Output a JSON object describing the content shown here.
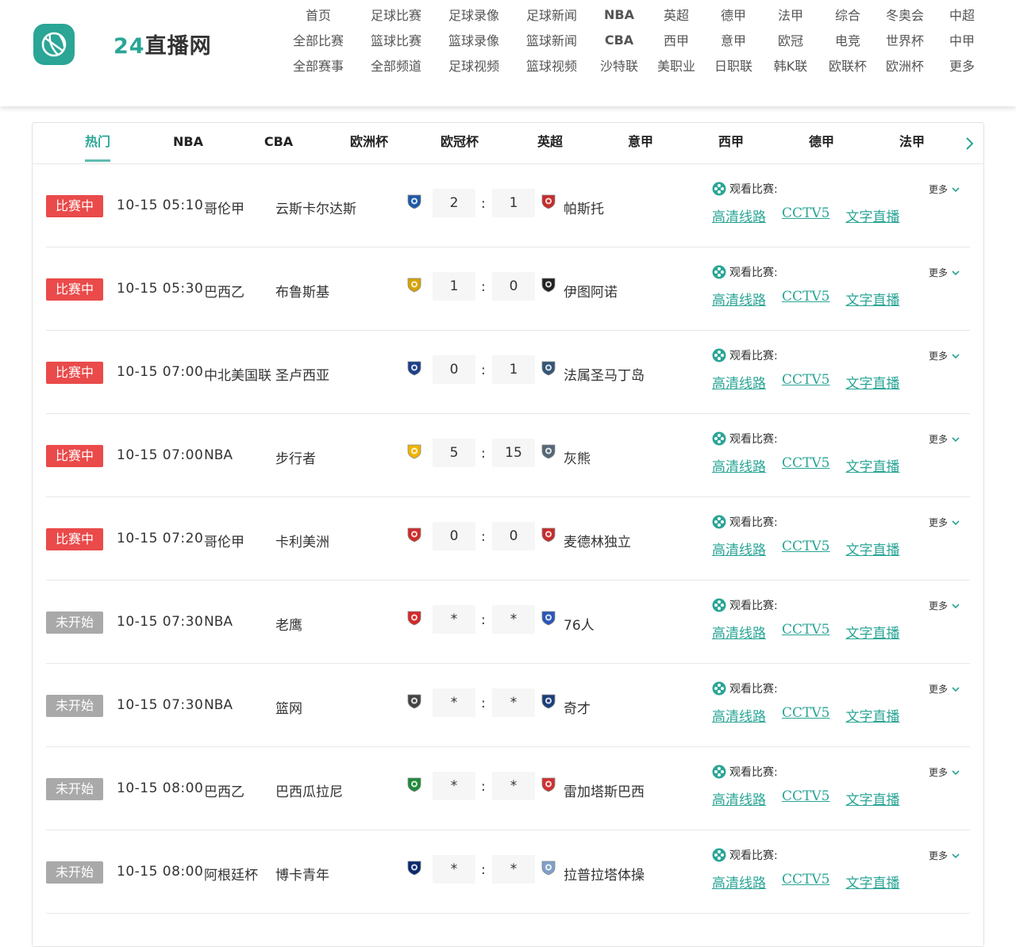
{
  "site": {
    "logo_prefix": "24",
    "logo_suffix": "直播网",
    "accent": "#2aa596"
  },
  "nav": [
    [
      "首页",
      "足球比赛",
      "足球录像",
      "足球新闻",
      "NBA",
      "英超",
      "德甲",
      "法甲",
      "综合",
      "冬奥会",
      "中超"
    ],
    [
      "全部比赛",
      "篮球比赛",
      "篮球录像",
      "篮球新闻",
      "CBA",
      "西甲",
      "意甲",
      "欧冠",
      "电竞",
      "世界杯",
      "中甲"
    ],
    [
      "全部赛事",
      "全部频道",
      "足球视频",
      "篮球视频",
      "沙特联",
      "美职业",
      "日职联",
      "韩K联",
      "欧联杯",
      "欧洲杯",
      "更多"
    ]
  ],
  "tabs": [
    "热门",
    "NBA",
    "CBA",
    "欧洲杯",
    "欧冠杯",
    "英超",
    "意甲",
    "西甲",
    "德甲",
    "法甲"
  ],
  "labels": {
    "watch": "观看比赛:",
    "more": "更多"
  },
  "matches": [
    {
      "status": "比赛中",
      "state": "live",
      "time": "10-15 05:10",
      "league": "哥伦甲",
      "home": "云斯卡尔达斯",
      "home_score": "2",
      "away_score": "1",
      "away": "帕斯托",
      "links": [
        "高清线路",
        "CCTV5",
        "文字直播"
      ]
    },
    {
      "status": "比赛中",
      "state": "live",
      "time": "10-15 05:30",
      "league": "巴西乙",
      "home": "布鲁斯基",
      "home_score": "1",
      "away_score": "0",
      "away": "伊图阿诺",
      "links": [
        "高清线路",
        "CCTV5",
        "文字直播"
      ]
    },
    {
      "status": "比赛中",
      "state": "live",
      "time": "10-15 07:00",
      "league": "中北美国联",
      "home": "圣卢西亚",
      "home_score": "0",
      "away_score": "1",
      "away": "法属圣马丁岛",
      "links": [
        "高清线路",
        "CCTV5",
        "文字直播"
      ]
    },
    {
      "status": "比赛中",
      "state": "live",
      "time": "10-15 07:00",
      "league": "NBA",
      "home": "步行者",
      "home_score": "5",
      "away_score": "15",
      "away": "灰熊",
      "links": [
        "高清线路",
        "CCTV5",
        "文字直播"
      ]
    },
    {
      "status": "比赛中",
      "state": "live",
      "time": "10-15 07:20",
      "league": "哥伦甲",
      "home": "卡利美洲",
      "home_score": "0",
      "away_score": "0",
      "away": "麦德林独立",
      "links": [
        "高清线路",
        "CCTV5",
        "文字直播"
      ]
    },
    {
      "status": "未开始",
      "state": "soon",
      "time": "10-15 07:30",
      "league": "NBA",
      "home": "老鹰",
      "home_score": "*",
      "away_score": "*",
      "away": "76人",
      "links": [
        "高清线路",
        "CCTV5",
        "文字直播"
      ]
    },
    {
      "status": "未开始",
      "state": "soon",
      "time": "10-15 07:30",
      "league": "NBA",
      "home": "篮网",
      "home_score": "*",
      "away_score": "*",
      "away": "奇才",
      "links": [
        "高清线路",
        "CCTV5",
        "文字直播"
      ]
    },
    {
      "status": "未开始",
      "state": "soon",
      "time": "10-15 08:00",
      "league": "巴西乙",
      "home": "巴西瓜拉尼",
      "home_score": "*",
      "away_score": "*",
      "away": "雷加塔斯巴西",
      "links": [
        "高清线路",
        "CCTV5",
        "文字直播"
      ]
    },
    {
      "status": "未开始",
      "state": "soon",
      "time": "10-15 08:00",
      "league": "阿根廷杯",
      "home": "博卡青年",
      "home_score": "*",
      "away_score": "*",
      "away": "拉普拉塔体操",
      "links": [
        "高清线路",
        "CCTV5",
        "文字直播"
      ]
    }
  ],
  "crest_colors": {
    "home": [
      "#1e5aa8",
      "#d6a300",
      "#1c3f8a",
      "#f0b400",
      "#d02a2a",
      "#d4282a",
      "#444444",
      "#1e8a3a",
      "#0a2a6e"
    ],
    "away": [
      "#c62c2c",
      "#222222",
      "#335577",
      "#556677",
      "#c62c2c",
      "#2a57b8",
      "#1b3f7a",
      "#d03030",
      "#7fa0c8"
    ]
  }
}
